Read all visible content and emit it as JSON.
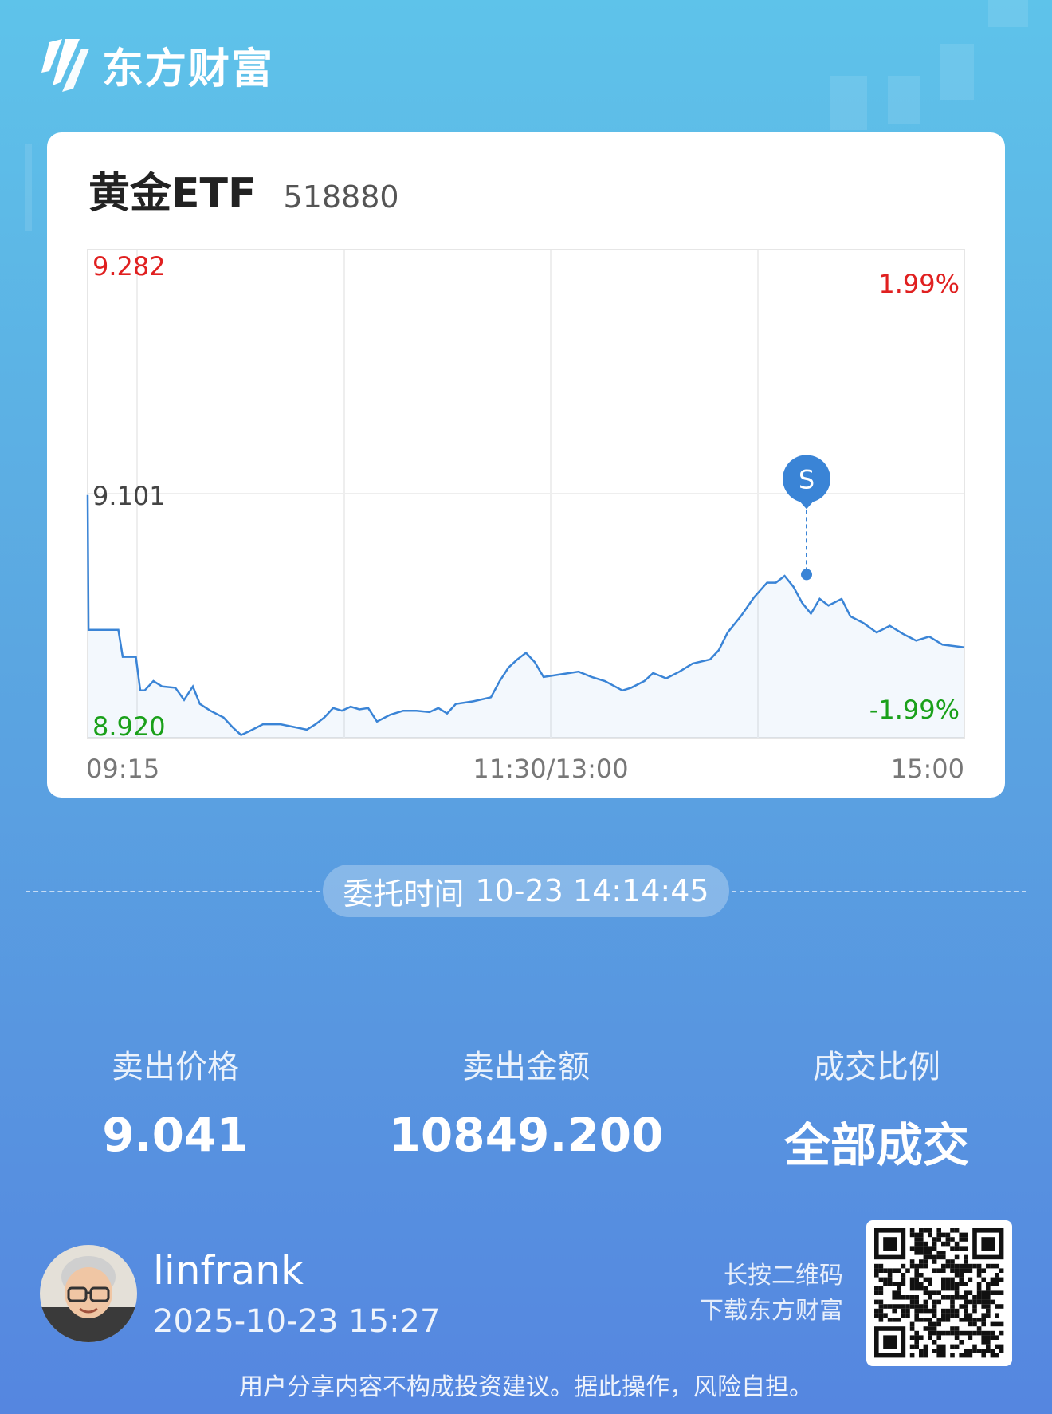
{
  "brand": {
    "name": "东方财富",
    "icon": "eastmoney-logo-icon"
  },
  "card": {
    "stock_name": "黄金ETF",
    "stock_code": "518880"
  },
  "chart_data": {
    "type": "line",
    "ylim": [
      8.92,
      9.282
    ],
    "y_labels": {
      "top": "9.282",
      "mid": "9.101",
      "bottom": "8.920"
    },
    "pct_labels": {
      "top": "1.99%",
      "bottom": "-1.99%"
    },
    "x_labels": [
      "09:15",
      "11:30/13:00",
      "15:00"
    ],
    "colors": {
      "up": "#e02020",
      "down": "#1aa01a",
      "line": "#3a84d6",
      "marker": "#3a84d6"
    },
    "marker": {
      "label": "S",
      "x": 0.82,
      "y": 9.041
    },
    "series": [
      {
        "points": [
          [
            0,
            9.1
          ],
          [
            0.001,
            9.0
          ],
          [
            0.035,
            9.0
          ],
          [
            0.04,
            8.98
          ],
          [
            0.055,
            8.98
          ],
          [
            0.06,
            8.955
          ],
          [
            0.065,
            8.955
          ],
          [
            0.075,
            8.962
          ],
          [
            0.085,
            8.958
          ],
          [
            0.1,
            8.957
          ],
          [
            0.11,
            8.948
          ],
          [
            0.12,
            8.958
          ],
          [
            0.128,
            8.945
          ],
          [
            0.14,
            8.94
          ],
          [
            0.155,
            8.935
          ],
          [
            0.165,
            8.928
          ],
          [
            0.175,
            8.922
          ],
          [
            0.185,
            8.925
          ],
          [
            0.2,
            8.93
          ],
          [
            0.22,
            8.93
          ],
          [
            0.235,
            8.928
          ],
          [
            0.25,
            8.926
          ],
          [
            0.26,
            8.93
          ],
          [
            0.27,
            8.935
          ],
          [
            0.28,
            8.942
          ],
          [
            0.29,
            8.94
          ],
          [
            0.3,
            8.943
          ],
          [
            0.31,
            8.941
          ],
          [
            0.32,
            8.942
          ],
          [
            0.33,
            8.932
          ],
          [
            0.345,
            8.937
          ],
          [
            0.36,
            8.94
          ],
          [
            0.375,
            8.94
          ],
          [
            0.39,
            8.939
          ],
          [
            0.4,
            8.942
          ],
          [
            0.41,
            8.938
          ],
          [
            0.42,
            8.945
          ],
          [
            0.44,
            8.947
          ],
          [
            0.46,
            8.95
          ],
          [
            0.47,
            8.962
          ],
          [
            0.48,
            8.972
          ],
          [
            0.49,
            8.978
          ],
          [
            0.5,
            8.983
          ],
          [
            0.51,
            8.976
          ],
          [
            0.52,
            8.965
          ],
          [
            0.54,
            8.967
          ],
          [
            0.56,
            8.969
          ],
          [
            0.575,
            8.965
          ],
          [
            0.59,
            8.962
          ],
          [
            0.61,
            8.955
          ],
          [
            0.62,
            8.957
          ],
          [
            0.635,
            8.962
          ],
          [
            0.645,
            8.968
          ],
          [
            0.66,
            8.964
          ],
          [
            0.675,
            8.969
          ],
          [
            0.69,
            8.975
          ],
          [
            0.71,
            8.978
          ],
          [
            0.72,
            8.985
          ],
          [
            0.73,
            8.998
          ],
          [
            0.745,
            9.01
          ],
          [
            0.76,
            9.024
          ],
          [
            0.775,
            9.035
          ],
          [
            0.785,
            9.035
          ],
          [
            0.795,
            9.04
          ],
          [
            0.805,
            9.032
          ],
          [
            0.815,
            9.02
          ],
          [
            0.825,
            9.012
          ],
          [
            0.835,
            9.023
          ],
          [
            0.845,
            9.018
          ],
          [
            0.86,
            9.023
          ],
          [
            0.87,
            9.01
          ],
          [
            0.885,
            9.005
          ],
          [
            0.9,
            8.998
          ],
          [
            0.915,
            9.003
          ],
          [
            0.93,
            8.997
          ],
          [
            0.945,
            8.992
          ],
          [
            0.96,
            8.995
          ],
          [
            0.975,
            8.989
          ],
          [
            1.0,
            8.987
          ]
        ]
      }
    ]
  },
  "order": {
    "label": "委托时间",
    "time": "10-23 14:14:45"
  },
  "stats": [
    {
      "label": "卖出价格",
      "value": "9.041"
    },
    {
      "label": "卖出金额",
      "value": "10849.200"
    },
    {
      "label": "成交比例",
      "value": "全部成交"
    }
  ],
  "user": {
    "name": "linfrank",
    "datetime": "2025-10-23 15:27",
    "avatar_icon": "memoji-avatar-icon"
  },
  "qr": {
    "line1": "长按二维码",
    "line2": "下载东方财富",
    "icon": "qr-code-icon"
  },
  "disclaimer": "用户分享内容不构成投资建议。据此操作，风险自担。"
}
